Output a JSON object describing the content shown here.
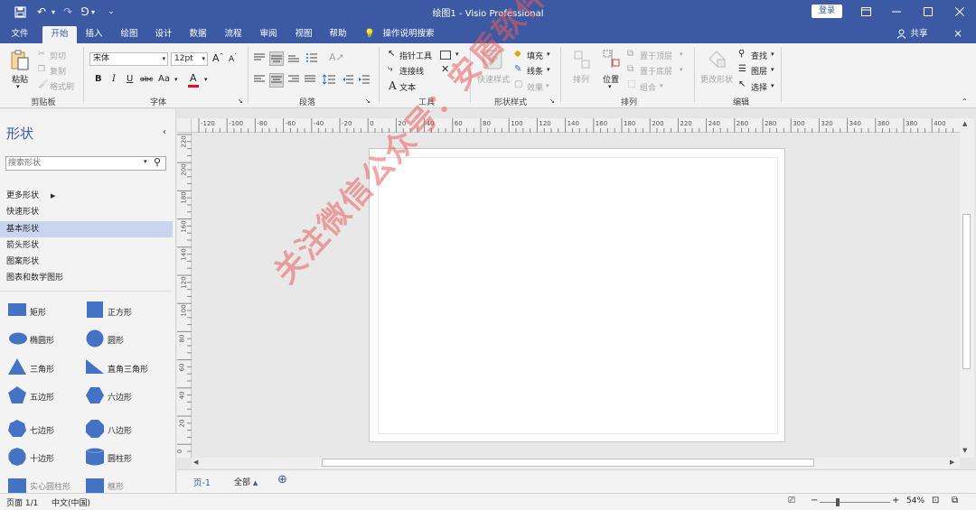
{
  "window": {
    "title": "绘图1  -  Visio Professional",
    "login_label": "登录"
  },
  "menu_tabs": [
    "文件",
    "开始",
    "插入",
    "绘图",
    "设计",
    "数据",
    "流程",
    "审阅",
    "视图",
    "帮助"
  ],
  "search_ops": "操作说明搜索",
  "share_label": "共享",
  "ribbon": {
    "clipboard": {
      "paste": "粘贴",
      "cut": "剪切",
      "copy": "复制",
      "painter": "格式刷",
      "label": "剪贴板"
    },
    "font": {
      "family": "宋体",
      "size": "12pt",
      "label": "字体",
      "bold": "B",
      "italic": "I",
      "underline": "U",
      "strike": "abc",
      "case": "Aa",
      "grow": "A",
      "shrink": "A",
      "color": "A",
      "color_value": "#e81123"
    },
    "paragraph": {
      "label": "段落"
    },
    "tools": {
      "pointer": "指针工具",
      "connector": "连接线",
      "text": "文本",
      "label": "工具"
    },
    "shape_style": {
      "quick": "快速样式",
      "fill": "填充",
      "line": "线条",
      "effect": "效果",
      "label": "形状样式"
    },
    "arrange": {
      "arrange": "排列",
      "position": "位置",
      "front": "置于顶层",
      "back": "置于底层",
      "group": "组合",
      "label": "排列"
    },
    "edit": {
      "change": "更改形状",
      "find": "查找",
      "layer": "图层",
      "select": "选择",
      "label": "编辑"
    }
  },
  "sidebar": {
    "title": "形状",
    "search_placeholder": "搜索形状",
    "categories": [
      "更多形状",
      "快速形状",
      "基本形状",
      "箭头形状",
      "图案形状",
      "图表和数学图形"
    ],
    "shapes": [
      "矩形",
      "正方形",
      "椭圆形",
      "圆形",
      "三角形",
      "直角三角形",
      "五边形",
      "六边形",
      "七边形",
      "八边形",
      "十边形",
      "圆柱形",
      "实心圆柱形",
      "框形"
    ]
  },
  "ruler": {
    "top": [
      "-120",
      "-100",
      "-80",
      "-60",
      "-40",
      "-20",
      "0",
      "20",
      "40",
      "60",
      "80",
      "100",
      "120",
      "140",
      "160",
      "180",
      "200",
      "220",
      "240",
      "260",
      "280",
      "300",
      "320",
      "340",
      "360",
      "380",
      "400"
    ],
    "left": [
      "220",
      "200",
      "180",
      "160",
      "140",
      "120",
      "100",
      "80",
      "60",
      "40",
      "20",
      "0"
    ]
  },
  "page_tabs": {
    "page": "页-1",
    "all": "全部"
  },
  "status": {
    "page": "页面 1/1",
    "lang": "中文(中国)",
    "zoom": "54%"
  },
  "watermark": "关注微信公众号：安盾软件管家",
  "colors": {
    "accent": "#3b5aa3",
    "shape_fill": "#4472c4",
    "selected_category": "#c9d5ef"
  }
}
